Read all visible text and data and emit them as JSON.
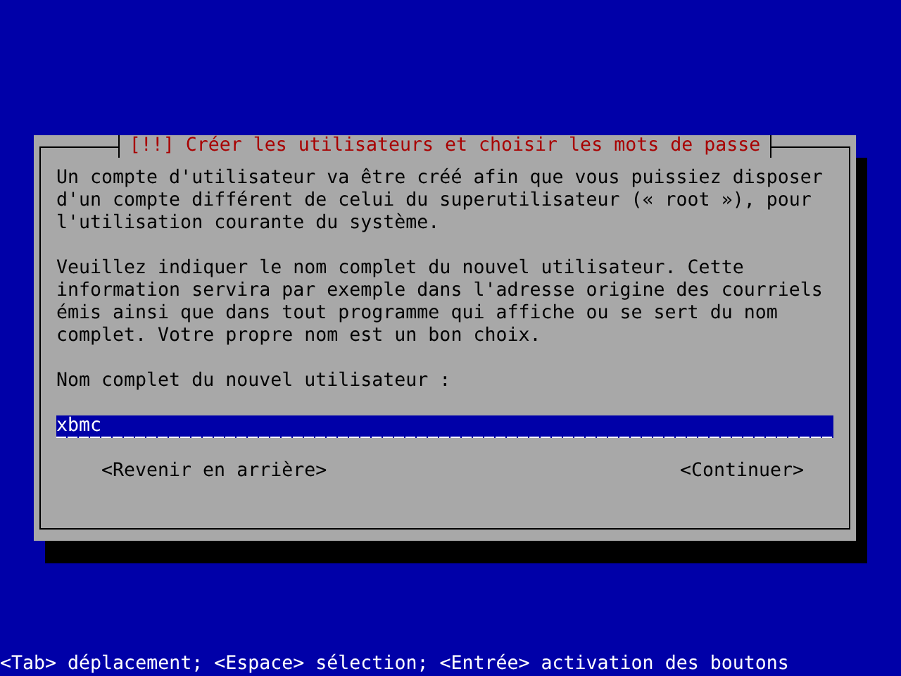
{
  "dialog": {
    "title": "[!!] Créer les utilisateurs et choisir les mots de passe",
    "paragraphs": [
      "Un compte d'utilisateur va être créé afin que vous puissiez disposer d'un compte différent de celui du superutilisateur (« root »), pour l'utilisation courante du système.",
      "Veuillez indiquer le nom complet du nouvel utilisateur. Cette information servira par exemple dans l'adresse origine des courriels émis ainsi que dans tout programme qui affiche ou se sert du nom complet. Votre propre nom est un bon choix."
    ],
    "field": {
      "label": "Nom complet du nouvel utilisateur :",
      "value": "xbmc"
    },
    "buttons": [
      {
        "label": "<Revenir en arrière>"
      },
      {
        "label": "<Continuer>"
      }
    ]
  },
  "status_bar": "<Tab> déplacement; <Espace> sélection; <Entrée> activation des boutons"
}
